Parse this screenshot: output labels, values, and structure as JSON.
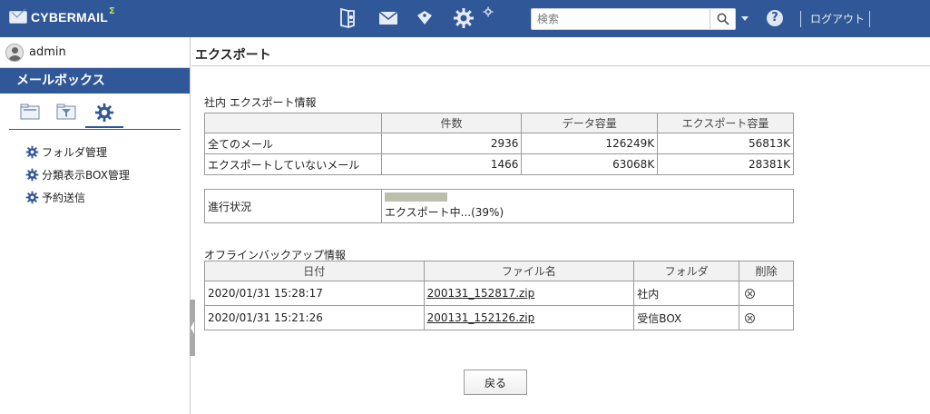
{
  "app": {
    "brand": "CYBERMAIL",
    "brand_sup": "Σ"
  },
  "header": {
    "search_placeholder": "検索",
    "logout": "ログアウト",
    "help": "?"
  },
  "sidebar": {
    "username": "admin",
    "mailbox_title": "メールボックス",
    "items": [
      {
        "label": "フォルダ管理"
      },
      {
        "label": "分類表示BOX管理"
      },
      {
        "label": "予約送信"
      }
    ]
  },
  "main": {
    "title": "エクスポート",
    "internal_export": {
      "label": "社内 エクスポート情報",
      "headers": [
        "",
        "件数",
        "データ容量",
        "エクスポート容量"
      ],
      "rows": [
        [
          "全てのメール",
          "2936",
          "126249K",
          "56813K"
        ],
        [
          "エクスポートしていないメール",
          "1466",
          "63068K",
          "28381K"
        ]
      ]
    },
    "progress": {
      "label": "進行状況",
      "percent": 39,
      "text": "エクスポート中...(39%)"
    },
    "offline_backup": {
      "label": "オフラインバックアップ情報",
      "headers": [
        "日付",
        "ファイル名",
        "フォルダ",
        "削除"
      ],
      "rows": [
        {
          "date": "2020/01/31 15:28:17",
          "file": "200131_152817.zip",
          "folder": "社内"
        },
        {
          "date": "2020/01/31 15:21:26",
          "file": "200131_152126.zip",
          "folder": "受信BOX"
        }
      ]
    },
    "back_button": "戻る"
  }
}
